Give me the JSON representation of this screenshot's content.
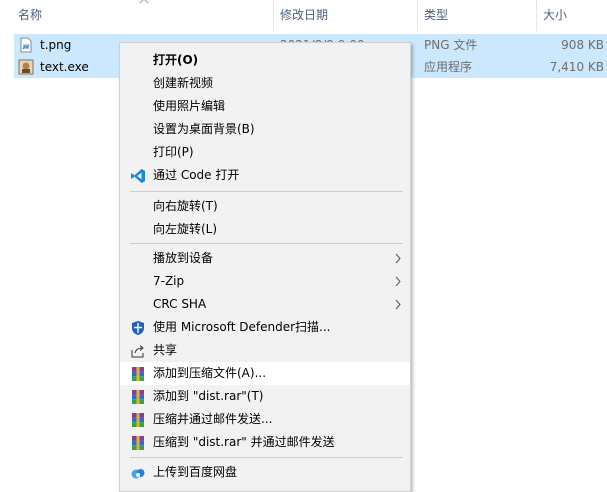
{
  "columns": {
    "name": "名称",
    "date": "修改日期",
    "type": "类型",
    "size": "大小"
  },
  "files": [
    {
      "name": "t.png",
      "date": "2021/8/9 9:00",
      "type": "PNG 文件",
      "size": "908 KB",
      "icon": "image-file-icon"
    },
    {
      "name": "text.exe",
      "date": "",
      "type": "应用程序",
      "size": "7,410 KB",
      "icon": "exe-file-icon"
    }
  ],
  "menu": {
    "open": "打开(O)",
    "create_video": "创建新视频",
    "edit_photos": "使用照片编辑",
    "set_wallpaper": "设置为桌面背景(B)",
    "print": "打印(P)",
    "open_with_code": "通过 Code 打开",
    "rotate_right": "向右旋转(T)",
    "rotate_left": "向左旋转(L)",
    "cast_to_device": "播放到设备",
    "seven_zip": "7-Zip",
    "crc_sha": "CRC SHA",
    "defender_scan": "使用 Microsoft Defender扫描...",
    "share": "共享",
    "add_to_archive": "添加到压缩文件(A)...",
    "add_to_dist_rar": "添加到 \"dist.rar\"(T)",
    "compress_and_email": "压缩并通过邮件发送...",
    "compress_dist_and_email": "压缩到 \"dist.rar\" 并通过邮件发送",
    "upload_baidu": "上传到百度网盘"
  },
  "colors": {
    "selection": "#cce8ff",
    "menu_bg": "#f2f2f2",
    "menu_hover": "#ffffff",
    "header_text": "#4c607a"
  }
}
